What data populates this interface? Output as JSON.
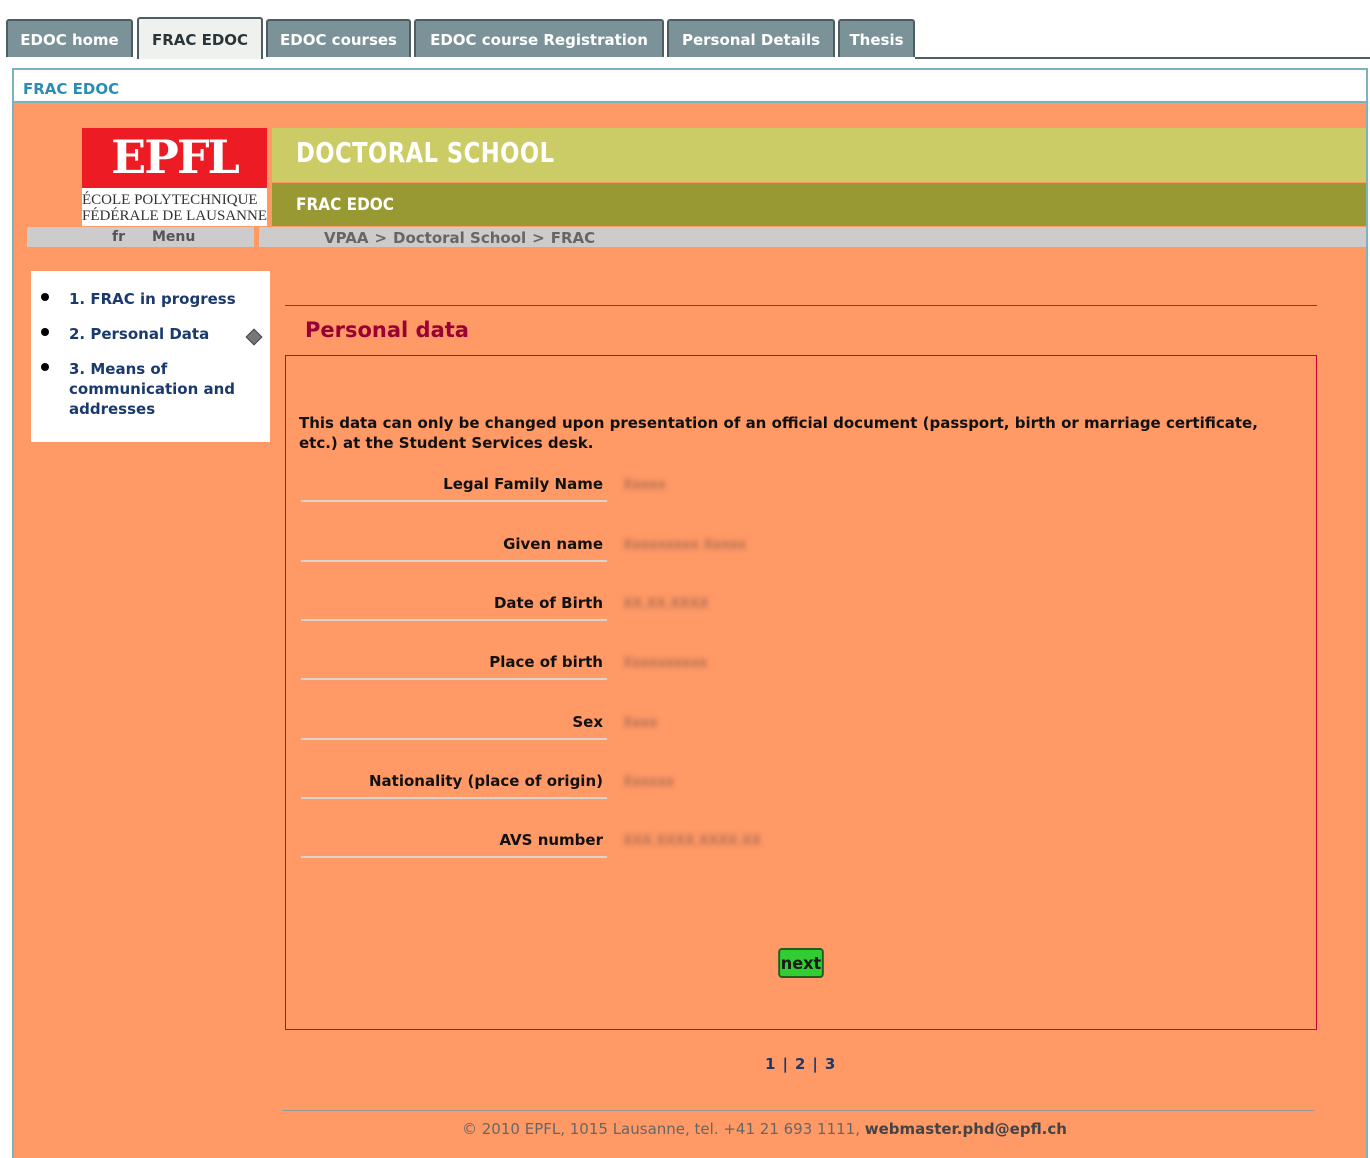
{
  "tabs": [
    {
      "label": "EDOC home",
      "active": false
    },
    {
      "label": "FRAC EDOC",
      "active": true
    },
    {
      "label": "EDOC courses",
      "active": false
    },
    {
      "label": "EDOC course Registration",
      "active": false
    },
    {
      "label": "Personal Details",
      "active": false
    },
    {
      "label": "Thesis",
      "active": false
    }
  ],
  "frame_title": "FRAC EDOC",
  "header": {
    "logo_mark": "EPFL",
    "logo_line1": "ÉCOLE POLYTECHNIQUE",
    "logo_line2": "FÉDÉRALE DE LAUSANNE",
    "school_title": "DOCTORAL SCHOOL",
    "subtitle": "FRAC EDOC",
    "lang": "fr",
    "menu": "Menu",
    "breadcrumbs": [
      "VPAA",
      "Doctoral School",
      "FRAC"
    ],
    "breadcrumb_sep": ">"
  },
  "sidenav": {
    "items": [
      {
        "label": "1. FRAC in progress"
      },
      {
        "label": "2. Personal Data",
        "current": true
      },
      {
        "label": "3. Means of communication and addresses"
      }
    ]
  },
  "section": {
    "title": "Personal data",
    "notice": "This data can only be changed upon presentation of an official document (passport, birth or marriage certificate, etc.) at the Student Services desk.",
    "fields": [
      {
        "label": "Legal Family Name",
        "value": "Xxxxx"
      },
      {
        "label": "Given name",
        "value": "Xxxxxxxxx Xxxxx"
      },
      {
        "label": "Date of Birth",
        "value": "XX.XX.XXXX"
      },
      {
        "label": "Place of birth",
        "value": "Xxxxxxxxxx"
      },
      {
        "label": "Sex",
        "value": "Xxxx"
      },
      {
        "label": "Nationality (place of origin)",
        "value": "Xxxxxx"
      },
      {
        "label": "AVS number",
        "value": "XXX.XXXX.XXXX.XX"
      }
    ],
    "next_label": "next"
  },
  "pager": [
    "1",
    "2",
    "3"
  ],
  "footer": {
    "text": "© 2010 EPFL, 1015 Lausanne, tel. +41 21 693 1111, ",
    "email": "webmaster.phd@epfl.ch"
  },
  "colors": {
    "page_bg": "#ff9966",
    "tab_bg": "#7b9398",
    "band_light": "#cccc66",
    "band_dark": "#999933",
    "title_red": "#990033",
    "next_green": "#33cc33"
  }
}
